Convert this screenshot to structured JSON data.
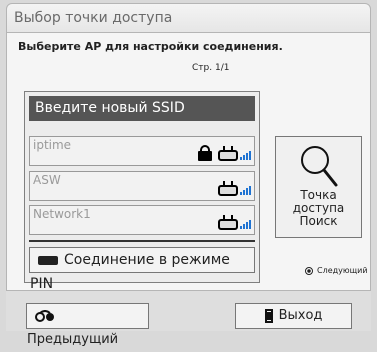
{
  "window": {
    "title": "Выбор точки доступа"
  },
  "instruction": "Выберите AP для настройки соединения.",
  "page_indicator": "Стр. 1/1",
  "new_ssid_label": "Введите новый SSID",
  "access_points": [
    {
      "name": "iptime",
      "locked": true,
      "icon": "router-wifi-icon"
    },
    {
      "name": "ASW",
      "locked": false,
      "icon": "router-wifi-icon"
    },
    {
      "name": "Network1",
      "locked": false,
      "icon": "router-wifi-icon"
    }
  ],
  "pin_connection_label": "Соединение в режиме PIN",
  "search": {
    "label_line1": "Точка",
    "label_line2": "доступа",
    "label_line3": "Поиск",
    "icon": "search-icon"
  },
  "next_label": "Следующий",
  "footer": {
    "previous_label": "Предыдущий",
    "exit_label": "Выход"
  },
  "colors": {
    "highlight": "#555555",
    "signal": "#1f73d2"
  }
}
